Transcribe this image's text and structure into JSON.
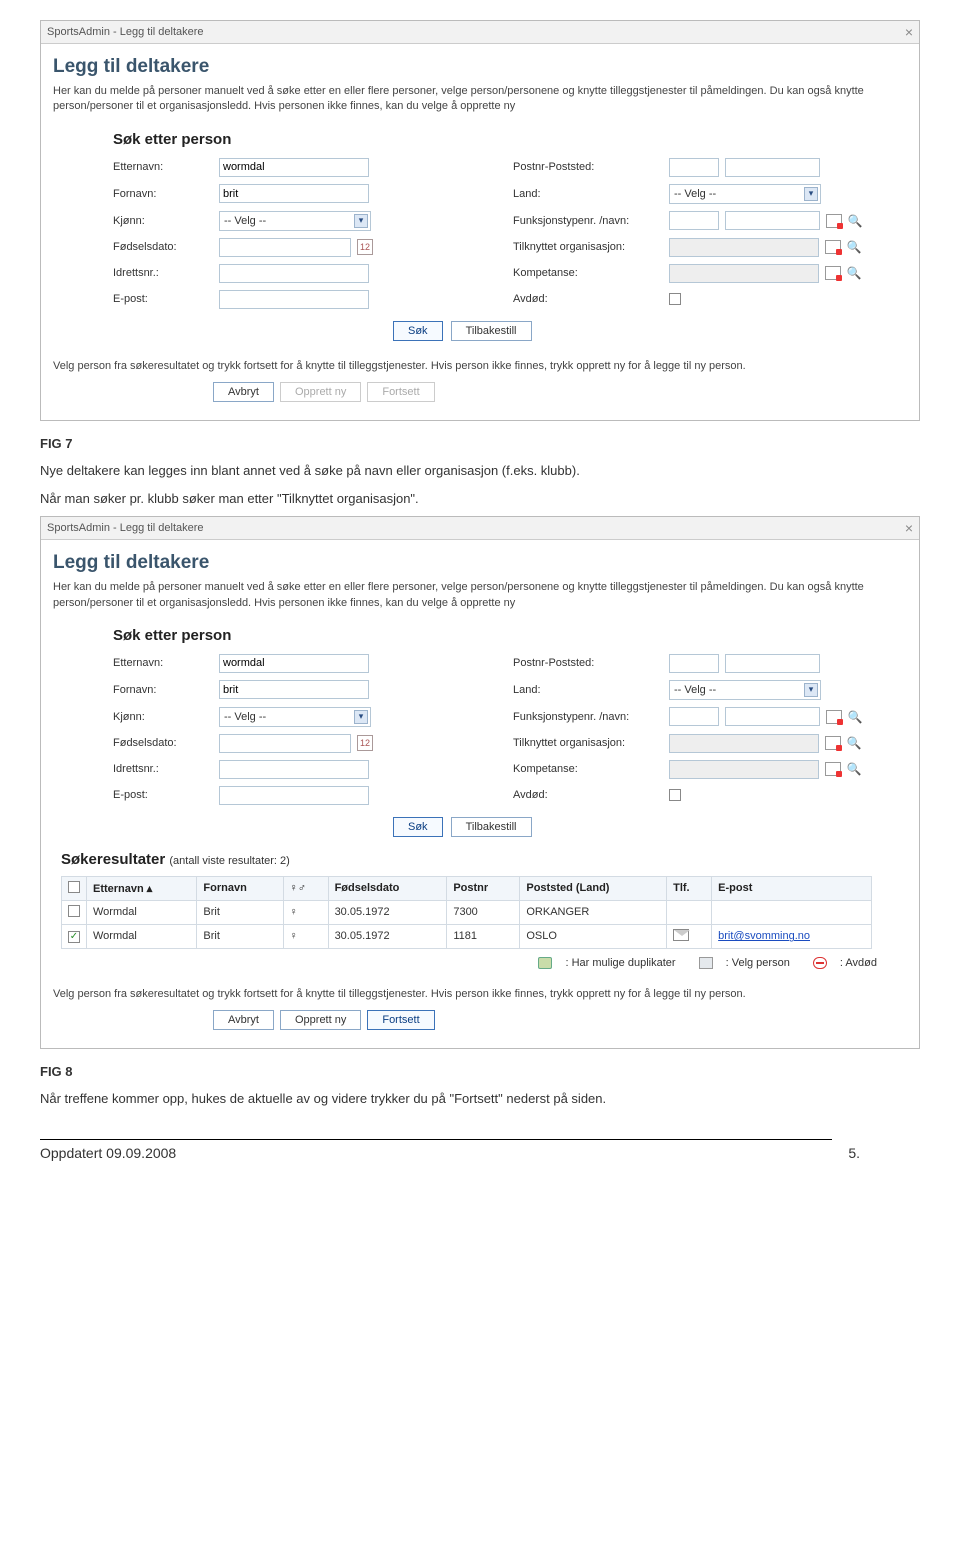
{
  "s1": {
    "titlebar": "SportsAdmin - Legg til deltakere",
    "h1": "Legg til deltakere",
    "intro": "Her kan du melde på personer manuelt ved å søke etter en eller flere personer, velge person/personene og knytte tilleggstjenester til påmeldingen. Du kan også knytte person/personer til et organisasjonsledd. Hvis personen ikke finnes, kan du velge å opprette ny",
    "h2": "Søk etter person",
    "labels": {
      "etternavn": "Etternavn:",
      "fornavn": "Fornavn:",
      "kjonn": "Kjønn:",
      "fodsel": "Fødselsdato:",
      "idrettsnr": "Idrettsnr.:",
      "epost": "E-post:",
      "postnr": "Postnr-Poststed:",
      "land": "Land:",
      "funk": "Funksjonstypenr. /navn:",
      "org": "Tilknyttet organisasjon:",
      "komp": "Kompetanse:",
      "avdod": "Avdød:"
    },
    "values": {
      "etternavn": "wormdal",
      "fornavn": "brit",
      "kjonn": "-- Velg --",
      "land": "-- Velg --"
    },
    "buttons": {
      "sok": "Søk",
      "tilbakestill": "Tilbakestill",
      "avbryt": "Avbryt",
      "opprett": "Opprett ny",
      "fortsett": "Fortsett"
    },
    "instr": "Velg person fra søkeresultatet og trykk fortsett for å knytte til tilleggstjenester. Hvis person ikke finnes, trykk opprett ny for å legge til ny person."
  },
  "doc": {
    "fig7": "FIG 7",
    "p7": "Nye deltakere kan legges inn blant annet ved å søke på navn eller organisasjon (f.eks. klubb).",
    "p7b": "Når man søker pr. klubb søker man etter \"Tilknyttet organisasjon\".",
    "fig8": "FIG 8",
    "p8": "Når treffene kommer opp, hukes de aktuelle av og videre trykker du på \"Fortsett\" nederst på siden.",
    "footer_date": "Oppdatert 09.09.2008",
    "footer_page": "5."
  },
  "s2": {
    "results_h": "Søkeresultater",
    "results_sub": "(antall viste resultater: 2)",
    "cols": {
      "etternavn": "Etternavn",
      "fornavn": "Fornavn",
      "fodsel": "Fødselsdato",
      "postnr": "Postnr",
      "poststed": "Poststed (Land)",
      "tlf": "Tlf.",
      "epost": "E-post"
    },
    "rows": [
      {
        "checked": false,
        "etternavn": "Wormdal",
        "fornavn": "Brit",
        "sex": "♀",
        "fodsel": "30.05.1972",
        "postnr": "7300",
        "poststed": "ORKANGER",
        "epost": ""
      },
      {
        "checked": true,
        "etternavn": "Wormdal",
        "fornavn": "Brit",
        "sex": "♀",
        "fodsel": "30.05.1972",
        "postnr": "1181",
        "poststed": "OSLO",
        "epost": "brit@svomming.no"
      }
    ],
    "legend": {
      "dup": ": Har mulige duplikater",
      "sel": ": Velg person",
      "dead": ": Avdød"
    }
  }
}
